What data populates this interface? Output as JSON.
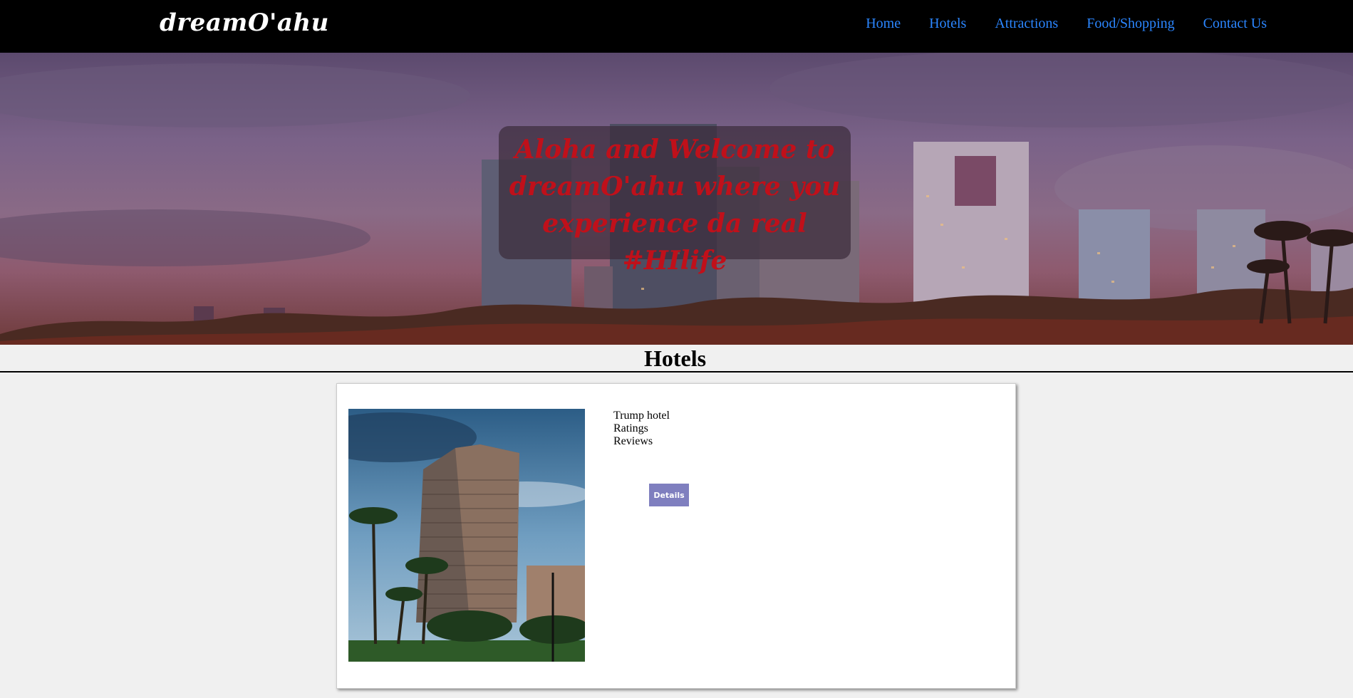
{
  "navbar": {
    "brand": "dreamO'ahu",
    "links": [
      {
        "label": "Home"
      },
      {
        "label": "Hotels"
      },
      {
        "label": "Attractions"
      },
      {
        "label": "Food/Shopping"
      },
      {
        "label": "Contact Us"
      }
    ]
  },
  "hero": {
    "lines": [
      "Aloha and Welcome to",
      "dreamO'ahu where you",
      "experience da real #HIlife"
    ]
  },
  "section": {
    "title": "Hotels"
  },
  "hotel_card": {
    "name": "Trump hotel",
    "ratings_label": "Ratings",
    "reviews_label": "Reviews",
    "details_label": "Details"
  },
  "colors": {
    "nav_bg": "#000000",
    "nav_link": "#2b86ff",
    "hero_text": "#c0101a",
    "button_bg": "#7f7fbf"
  }
}
